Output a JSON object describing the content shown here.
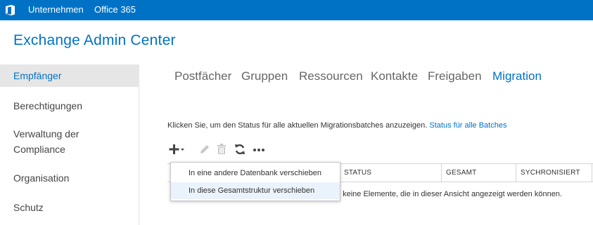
{
  "topbar": {
    "logo_icon": "office-logo-icon",
    "nav": [
      {
        "label": "Unternehmen",
        "active": true
      },
      {
        "label": "Office 365",
        "active": false
      }
    ],
    "background": "#0072c6"
  },
  "app": {
    "title": "Exchange Admin Center"
  },
  "sidebar": {
    "items": [
      {
        "label": "Empfänger",
        "selected": true
      },
      {
        "label": "Berechtigungen",
        "selected": false
      },
      {
        "label": "Verwaltung der Compliance",
        "selected": false
      },
      {
        "label": "Organisation",
        "selected": false
      },
      {
        "label": "Schutz",
        "selected": false
      }
    ]
  },
  "tabs": [
    {
      "label": "Postfächer",
      "active": false
    },
    {
      "label": "Gruppen",
      "active": false
    },
    {
      "label": "Ressourcen",
      "active": false
    },
    {
      "label": "Kontakte",
      "active": false
    },
    {
      "label": "Freigaben",
      "active": false
    },
    {
      "label": "Migration",
      "active": true
    }
  ],
  "info": {
    "text": "Klicken Sie, um den Status für alle aktuellen Migrationsbatches anzuzeigen.",
    "link": "Status für alle Batches"
  },
  "toolbar": {
    "buttons": [
      {
        "icon": "add-dropdown-icon",
        "enabled": true
      },
      {
        "icon": "pencil-icon",
        "enabled": false
      },
      {
        "icon": "trash-icon",
        "enabled": false
      },
      {
        "icon": "refresh-icon",
        "enabled": true
      },
      {
        "icon": "more-options-icon",
        "enabled": true
      }
    ]
  },
  "table": {
    "columns": [
      "STATUS",
      "GESAMT",
      "SYCHRONISIERT"
    ],
    "empty_message": "t keine Elemente, die in dieser Ansicht angezeigt werden können."
  },
  "dropdown": {
    "items": [
      {
        "label": "In eine andere Datenbank verschieben",
        "highlighted": false
      },
      {
        "label": "In diese Gesamtstruktur verschieben",
        "highlighted": true
      }
    ]
  },
  "colors": {
    "accent": "#0072c6",
    "selected_bg": "#e6e6e6",
    "hover_bg": "#eaf3fb"
  }
}
